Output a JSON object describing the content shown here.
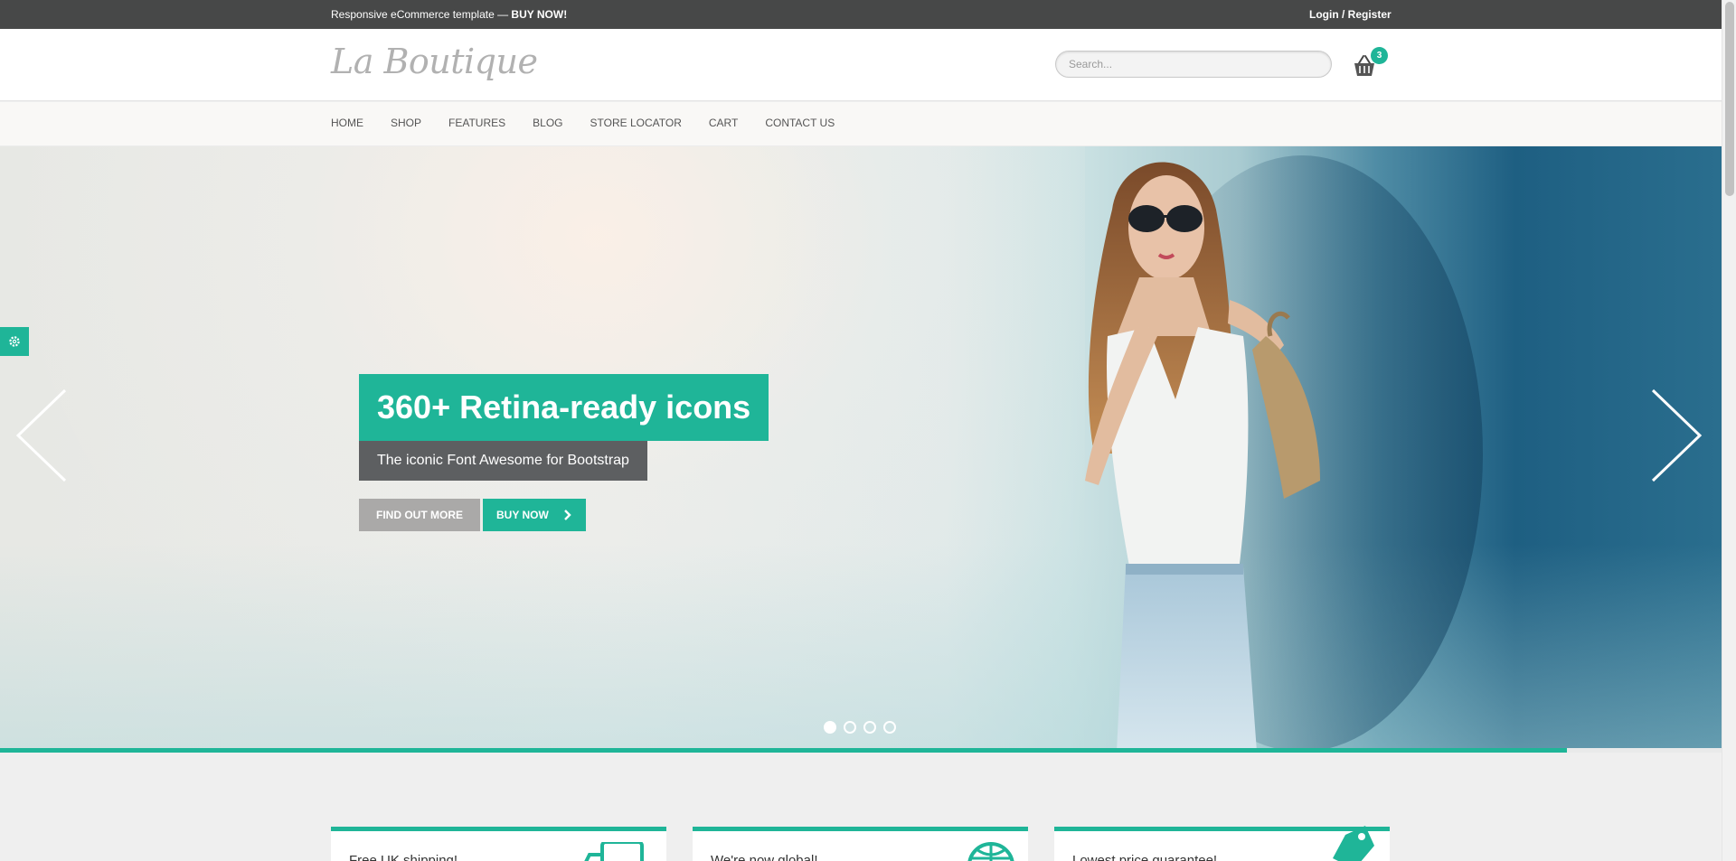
{
  "topbar": {
    "promo_text": "Responsive eCommerce template — ",
    "promo_cta": "BUY NOW!",
    "login_label": "Login / Register"
  },
  "header": {
    "logo_text": "La Boutique",
    "search_placeholder": "Search...",
    "cart_count": "3"
  },
  "nav": {
    "items": [
      "HOME",
      "SHOP",
      "FEATURES",
      "BLOG",
      "STORE LOCATOR",
      "CART",
      "CONTACT US"
    ]
  },
  "hero": {
    "title": "360+ Retina-ready icons",
    "subtitle": "The iconic Font Awesome for Bootstrap",
    "find_out_more_label": "FIND OUT MORE",
    "buy_now_label": "BUY NOW",
    "slide_count": 4,
    "active_slide": 1,
    "progress_fraction": 0.91
  },
  "features": [
    {
      "title": "Free UK shipping!",
      "icon": "truck-icon"
    },
    {
      "title": "We're now global!",
      "icon": "globe-icon"
    },
    {
      "title": "Lowest price guarantee!",
      "icon": "price-tag-icon"
    }
  ],
  "colors": {
    "accent": "#1fb598",
    "topbar": "#474848",
    "subtitle_bg": "#5d5f61",
    "secondary_button": "#aaa9a8"
  }
}
